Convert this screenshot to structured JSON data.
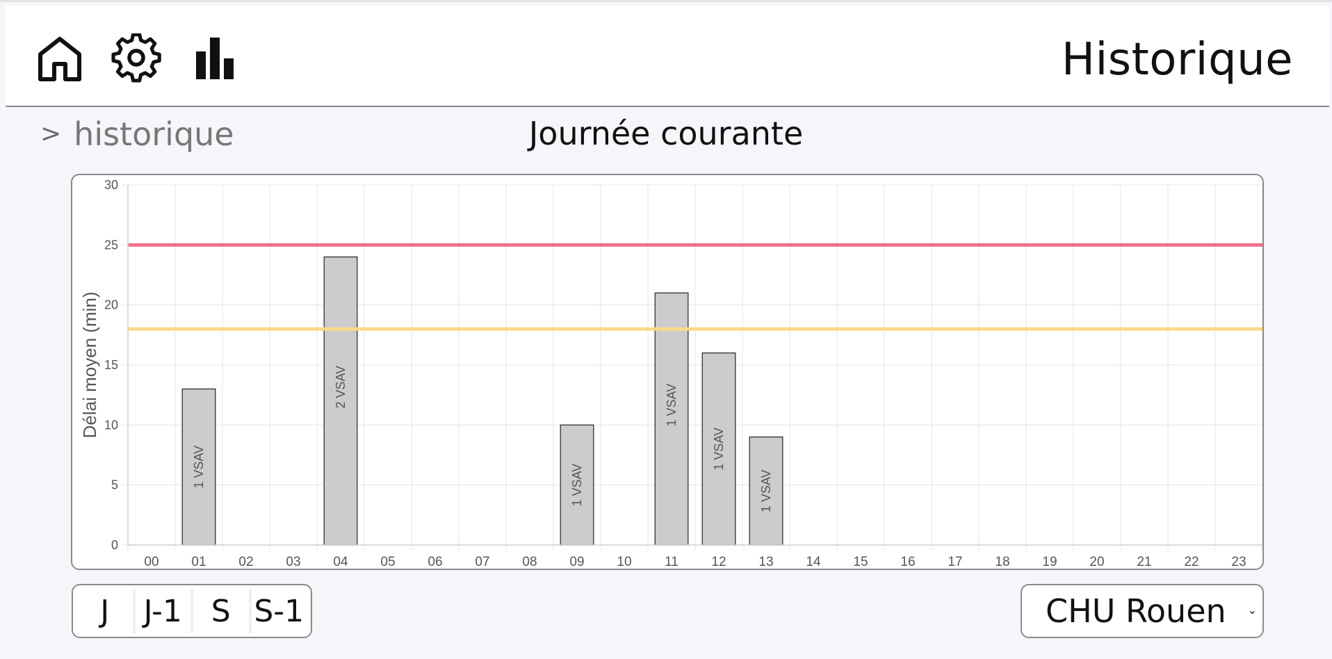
{
  "header": {
    "title": "Historique",
    "nav": [
      {
        "name": "home-icon"
      },
      {
        "name": "gear-icon"
      },
      {
        "name": "bar-chart-icon"
      }
    ]
  },
  "breadcrumb": {
    "chevron": ">",
    "label": "historique"
  },
  "subtitle": "Journée courante",
  "chart_data": {
    "type": "bar",
    "categories": [
      "00",
      "01",
      "02",
      "03",
      "04",
      "05",
      "06",
      "07",
      "08",
      "09",
      "10",
      "11",
      "12",
      "13",
      "14",
      "15",
      "16",
      "17",
      "18",
      "19",
      "20",
      "21",
      "22",
      "23"
    ],
    "values": [
      null,
      13,
      null,
      null,
      24,
      null,
      null,
      null,
      null,
      10,
      null,
      21,
      16,
      9,
      null,
      null,
      null,
      null,
      null,
      null,
      null,
      null,
      null,
      null
    ],
    "bar_labels": [
      "",
      "1 VSAV",
      "",
      "",
      "2 VSAV",
      "",
      "",
      "",
      "",
      "1 VSAV",
      "",
      "1 VSAV",
      "1 VSAV",
      "1 VSAV",
      "",
      "",
      "",
      "",
      "",
      "",
      "",
      "",
      "",
      ""
    ],
    "ylabel": "Délai moyen (min)",
    "xlabel": "",
    "ylim": [
      0,
      30
    ],
    "yticks": [
      0,
      5,
      10,
      15,
      20,
      25,
      30
    ],
    "grid": true,
    "thresholds": [
      {
        "value": 25,
        "color": "#f0728f"
      },
      {
        "value": 18,
        "color": "#fbd88a"
      }
    ],
    "bar_color": "#cccccc",
    "bar_border": "#222222"
  },
  "controls": {
    "periods": [
      {
        "label": "J"
      },
      {
        "label": "J-1"
      },
      {
        "label": "S"
      },
      {
        "label": "S-1"
      }
    ],
    "site": {
      "selected": "CHU Rouen",
      "caret": "⌄"
    }
  }
}
